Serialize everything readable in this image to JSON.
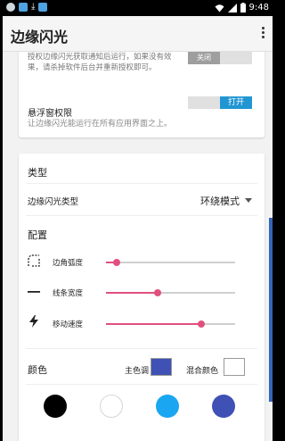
{
  "status_bar": {
    "time": "9:48",
    "icons": [
      "app-notification-icon",
      "photo-notification-icon",
      "download-icon",
      "app-notification-icon",
      "wifi-icon",
      "signal-icon",
      "battery-icon"
    ],
    "colors": {
      "bg": "#000000",
      "text": "#ffffff"
    }
  },
  "appbar": {
    "title": "边缘闪光",
    "menu_icon": "more-vert-icon"
  },
  "permissions": {
    "notification_desc": "授权边缘闪光获取通知后运行，如果没有效果，请杀掉软件后台并重新授权即可。",
    "notification_button": "关闭",
    "overlay_title": "悬浮窗权限",
    "overlay_desc": "让边缘闪光能运行在所有应用界面之上。",
    "overlay_button": "打开"
  },
  "type_section": {
    "title": "类型",
    "row_label": "边缘闪光类型",
    "selected_value": "环绕模式"
  },
  "config_section": {
    "title": "配置",
    "sliders": [
      {
        "label": "边角弧度",
        "icon": "corner-radius-icon",
        "value": 0.08
      },
      {
        "label": "线条宽度",
        "icon": "line-width-icon",
        "value": 0.4
      },
      {
        "label": "移动速度",
        "icon": "lightning-icon",
        "value": 0.74
      }
    ],
    "slider_color": "#e0507e"
  },
  "color_section": {
    "title": "颜色",
    "primary_label": "主色调",
    "primary_color": "#3f51b5",
    "mix_label": "混合颜色",
    "mix_color": "#ffffff",
    "presets": [
      "#000000",
      "#ffffff",
      "#1aa6f0",
      "#3f51b5"
    ]
  },
  "colors": {
    "accent": "#2196d3",
    "edge_flash": "#3466b8"
  }
}
